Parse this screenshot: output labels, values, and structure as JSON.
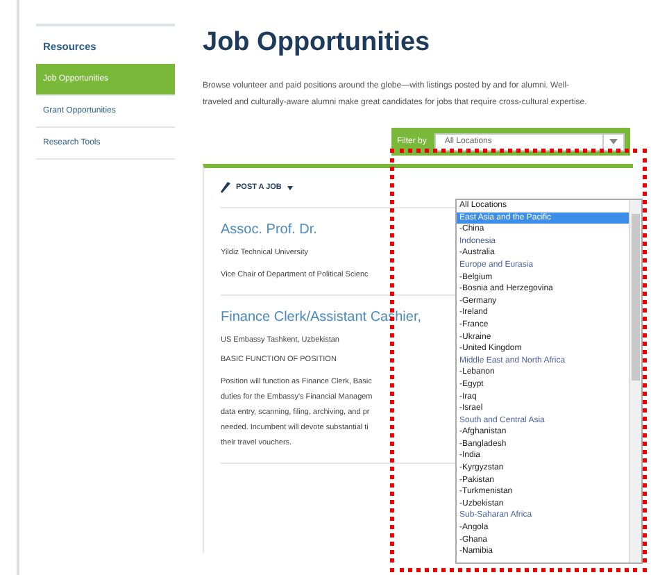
{
  "sidebar": {
    "title": "Resources",
    "items": [
      {
        "label": "Job Opportunities",
        "selected": true
      },
      {
        "label": "Grant Opportunities",
        "selected": false
      },
      {
        "label": "Research Tools",
        "selected": false
      }
    ]
  },
  "page": {
    "title": "Job Opportunities",
    "intro": "Browse volunteer and paid positions around the globe—with listings posted by and for alumni. Well-traveled and culturally-aware alumni make great candidates for jobs that require cross-cultural expertise."
  },
  "filter": {
    "label": "Filter by",
    "value": "All Locations",
    "options": [
      {
        "label": "All Locations",
        "kind": "option",
        "highlighted": false
      },
      {
        "label": "East Asia and the Pacific",
        "kind": "region",
        "highlighted": true
      },
      {
        "label": "-China",
        "kind": "option",
        "highlighted": false
      },
      {
        "label": "Indonesia",
        "kind": "region",
        "highlighted": false
      },
      {
        "label": "-Australia",
        "kind": "option",
        "highlighted": false
      },
      {
        "label": "Europe and Eurasia",
        "kind": "region",
        "highlighted": false
      },
      {
        "label": "-Belgium",
        "kind": "option",
        "highlighted": false
      },
      {
        "label": "-Bosnia and Herzegovina",
        "kind": "option",
        "highlighted": false
      },
      {
        "label": "-Germany",
        "kind": "option",
        "highlighted": false
      },
      {
        "label": "-Ireland",
        "kind": "option",
        "highlighted": false
      },
      {
        "label": "-France",
        "kind": "option",
        "highlighted": false
      },
      {
        "label": "-Ukraine",
        "kind": "option",
        "highlighted": false
      },
      {
        "label": "-United Kingdom",
        "kind": "option",
        "highlighted": false
      },
      {
        "label": "Middle East and North Africa",
        "kind": "region",
        "highlighted": false
      },
      {
        "label": "-Lebanon",
        "kind": "option",
        "highlighted": false
      },
      {
        "label": "-Egypt",
        "kind": "option",
        "highlighted": false
      },
      {
        "label": "-Iraq",
        "kind": "option",
        "highlighted": false
      },
      {
        "label": "-Israel",
        "kind": "option",
        "highlighted": false
      },
      {
        "label": "South and Central Asia",
        "kind": "region",
        "highlighted": false
      },
      {
        "label": "-Afghanistan",
        "kind": "option",
        "highlighted": false
      },
      {
        "label": "-Bangladesh",
        "kind": "option",
        "highlighted": false
      },
      {
        "label": "-India",
        "kind": "option",
        "highlighted": false
      },
      {
        "label": "-Kyrgyzstan",
        "kind": "option",
        "highlighted": false
      },
      {
        "label": "-Pakistan",
        "kind": "option",
        "highlighted": false
      },
      {
        "label": "-Turkmenistan",
        "kind": "option",
        "highlighted": false
      },
      {
        "label": "-Uzbekistan",
        "kind": "option",
        "highlighted": false
      },
      {
        "label": "Sub-Saharan Africa",
        "kind": "region",
        "highlighted": false
      },
      {
        "label": "-Angola",
        "kind": "option",
        "highlighted": false
      },
      {
        "label": "-Ghana",
        "kind": "option",
        "highlighted": false
      },
      {
        "label": "-Namibia",
        "kind": "option",
        "highlighted": false
      }
    ]
  },
  "post_job": {
    "label": "POST A JOB"
  },
  "jobs": [
    {
      "title": "Assoc. Prof. Dr.",
      "employer": "Yildiz Technical University",
      "description_lines": [
        "Vice Chair of Department of Political Scienc"
      ]
    },
    {
      "title": "Finance Clerk/Assistant Cashier,",
      "employer": "US Embassy Tashkent, Uzbekistan",
      "heading": "BASIC FUNCTION OF POSITION",
      "description_lines": [
        "Position will function as Finance Clerk, Basic",
        "duties for the Embassy's Financial Managem",
        "data entry, scanning, filing, archiving, and pr",
        "needed. Incumbent will devote substantial ti",
        "their travel vouchers."
      ]
    }
  ]
}
